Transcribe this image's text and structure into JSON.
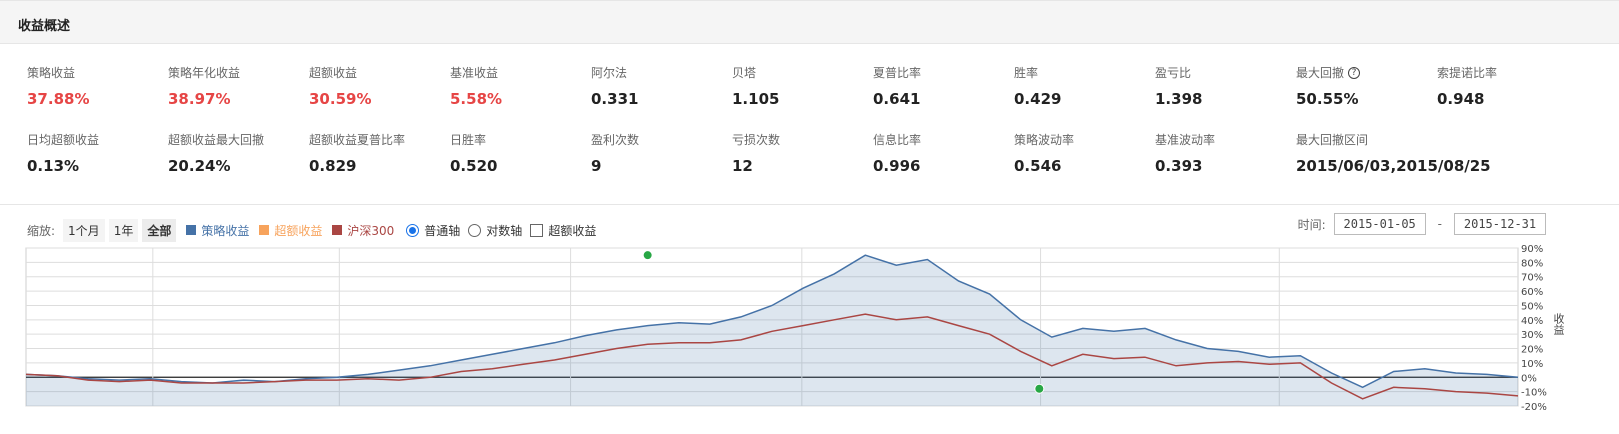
{
  "header": {
    "title": "收益概述"
  },
  "metrics_row1": [
    {
      "label": "策略收益",
      "value": "37.88%",
      "red": true
    },
    {
      "label": "策略年化收益",
      "value": "38.97%",
      "red": true
    },
    {
      "label": "超额收益",
      "value": "30.59%",
      "red": true
    },
    {
      "label": "基准收益",
      "value": "5.58%",
      "red": true
    },
    {
      "label": "阿尔法",
      "value": "0.331"
    },
    {
      "label": "贝塔",
      "value": "1.105"
    },
    {
      "label": "夏普比率",
      "value": "0.641"
    },
    {
      "label": "胜率",
      "value": "0.429"
    },
    {
      "label": "盈亏比",
      "value": "1.398"
    },
    {
      "label": "最大回撤",
      "value": "50.55%",
      "help": true
    },
    {
      "label": "索提诺比率",
      "value": "0.948"
    }
  ],
  "metrics_row2": [
    {
      "label": "日均超额收益",
      "value": "0.13%"
    },
    {
      "label": "超额收益最大回撤",
      "value": "20.24%"
    },
    {
      "label": "超额收益夏普比率",
      "value": "0.829"
    },
    {
      "label": "日胜率",
      "value": "0.520"
    },
    {
      "label": "盈利次数",
      "value": "9"
    },
    {
      "label": "亏损次数",
      "value": "12"
    },
    {
      "label": "信息比率",
      "value": "0.996"
    },
    {
      "label": "策略波动率",
      "value": "0.546"
    },
    {
      "label": "基准波动率",
      "value": "0.393"
    },
    {
      "label": "最大回撤区间",
      "value": "2015/06/03,2015/08/25"
    }
  ],
  "toolbar": {
    "zoom_label": "缩放:",
    "zoom_options": [
      "1个月",
      "1年",
      "全部"
    ],
    "zoom_active": "全部",
    "legend": [
      {
        "name": "策略收益",
        "color": "#4572a7"
      },
      {
        "name": "超额收益",
        "color": "#f7a35c"
      },
      {
        "name": "沪深300",
        "color": "#aa4643"
      }
    ],
    "axis_normal": "普通轴",
    "axis_log": "对数轴",
    "excess_checkbox": "超额收益"
  },
  "time_range": {
    "label": "时间:",
    "start": "2015-01-05",
    "end": "2015-12-31",
    "separator": "-"
  },
  "chart_data": {
    "type": "area",
    "ylabel": "收益",
    "ylim": [
      -20,
      90
    ],
    "yticks": [
      90,
      80,
      70,
      60,
      50,
      40,
      30,
      20,
      10,
      0,
      -10,
      -20
    ],
    "ytick_suffix": "%",
    "x": [
      0,
      5,
      10,
      15,
      20,
      25,
      30,
      35,
      40,
      45,
      50,
      55,
      60,
      65,
      70,
      75,
      80,
      85,
      90,
      95,
      100,
      105,
      110,
      115,
      120,
      125,
      130,
      135,
      140,
      145,
      150,
      155,
      160,
      165,
      170,
      175,
      180,
      185,
      190,
      195,
      200,
      205,
      210,
      215,
      220,
      225,
      230,
      235,
      240
    ],
    "series": [
      {
        "name": "策略收益",
        "color": "#4572a7",
        "fill": "rgba(69,114,167,0.18)",
        "values": [
          2,
          1,
          -1,
          -2,
          -1,
          -3,
          -4,
          -2,
          -3,
          -1,
          0,
          2,
          5,
          8,
          12,
          16,
          20,
          24,
          29,
          33,
          36,
          38,
          37,
          42,
          50,
          62,
          72,
          85,
          78,
          82,
          67,
          58,
          40,
          28,
          34,
          32,
          34,
          26,
          20,
          18,
          14,
          15,
          3,
          -7,
          4,
          6,
          3,
          2,
          0
        ]
      },
      {
        "name": "沪深300",
        "color": "#aa4643",
        "values": [
          2,
          1,
          -2,
          -3,
          -2,
          -4,
          -4,
          -4,
          -3,
          -2,
          -2,
          -1,
          -2,
          0,
          4,
          6,
          9,
          12,
          16,
          20,
          23,
          24,
          24,
          26,
          32,
          36,
          40,
          44,
          40,
          42,
          36,
          30,
          18,
          8,
          16,
          13,
          14,
          8,
          10,
          11,
          9,
          10,
          -4,
          -15,
          -7,
          -8,
          -10,
          -11,
          -13
        ]
      },
      {
        "name": "超额收益",
        "color": "#f7a35c",
        "values": []
      }
    ],
    "markers": [
      {
        "name": "max-point",
        "x": 100,
        "y": 85,
        "color": "#28a745"
      },
      {
        "name": "min-point",
        "x": 163,
        "y": -8,
        "color": "#28a745"
      }
    ],
    "grid": true,
    "legend": "top-left"
  }
}
